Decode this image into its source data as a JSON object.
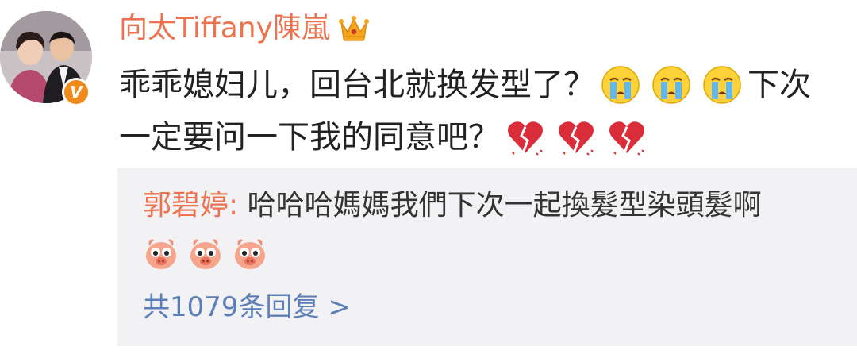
{
  "comment": {
    "author": "向太Tiffany陳嵐",
    "badge_icon": "crown-icon",
    "verified_mark": "V",
    "line1_text": "乖乖媳妇儿，回台北就换发型了？",
    "line1_emojis": [
      "crying-face-icon",
      "crying-face-icon",
      "crying-face-icon"
    ],
    "line1_tail": "下次",
    "line2_text": "一定要问一下我的同意吧？",
    "line2_emojis": [
      "broken-heart-icon",
      "broken-heart-icon",
      "broken-heart-icon"
    ]
  },
  "reply": {
    "author": "郭碧婷:",
    "text": "哈哈哈媽媽我們下次一起換髮型染頭髮啊",
    "emojis": [
      "cheering-pig-icon",
      "cheering-pig-icon",
      "cheering-pig-icon"
    ],
    "more_label": "共1079条回复 >"
  },
  "colors": {
    "username": "#eb7350",
    "link": "#5d7fb8",
    "panel_bg": "#f2f2f5",
    "verified": "#f08a1c"
  }
}
